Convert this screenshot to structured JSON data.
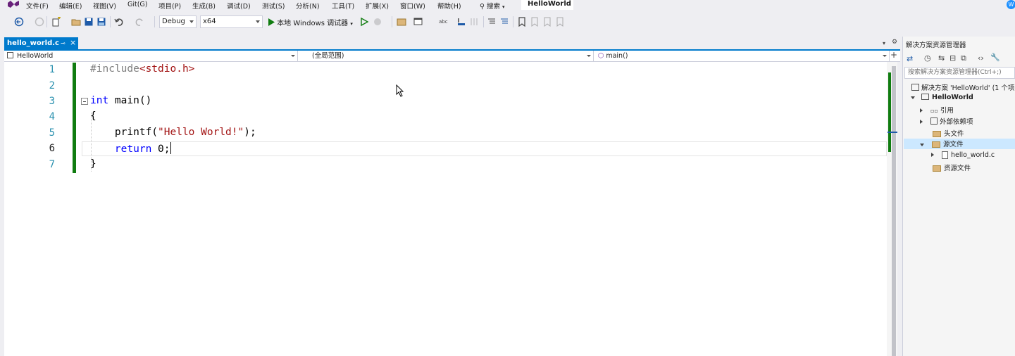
{
  "menu": [
    "文件(F)",
    "编辑(E)",
    "视图(V)",
    "Git(G)",
    "项目(P)",
    "生成(B)",
    "调试(D)",
    "测试(S)",
    "分析(N)",
    "工具(T)",
    "扩展(X)",
    "窗口(W)",
    "帮助(H)"
  ],
  "search_label": "搜索",
  "solution_name": "HelloWorld",
  "toolbar": {
    "config": "Debug",
    "platform": "x64",
    "run_label": "本地 Windows 调试器"
  },
  "tab": {
    "title": "hello_world.c",
    "pin": "⊸",
    "close": "×"
  },
  "navbar": {
    "project": "HelloWorld",
    "scope": "(全局范围)",
    "member": "main()"
  },
  "code": {
    "line_numbers": [
      "1",
      "2",
      "3",
      "4",
      "5",
      "6",
      "7"
    ],
    "lines": [
      [
        "#include",
        "<stdio.h>"
      ],
      [
        ""
      ],
      [
        "int",
        " main()"
      ],
      [
        "{"
      ],
      [
        "    printf(",
        "\"Hello World!\"",
        ");"
      ],
      [
        "    ",
        "return",
        " 0;"
      ],
      [
        "}"
      ]
    ]
  },
  "solution_explorer": {
    "title": "解决方案资源管理器",
    "search_placeholder": "搜索解决方案资源管理器(Ctrl+;)",
    "solution_label": "解决方案 'HelloWorld' (1 个项",
    "project": "HelloWorld",
    "items": {
      "references": "引用",
      "external": "外部依赖项",
      "headers": "头文件",
      "sources": "源文件",
      "source_file": "hello_world.c",
      "resources": "资源文件"
    }
  },
  "colors": {
    "accent": "#007acc",
    "change_bar": "#107c10",
    "keyword": "#0000ff",
    "string": "#a31515"
  }
}
